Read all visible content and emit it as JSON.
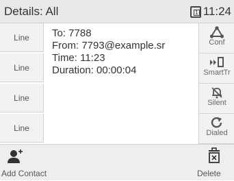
{
  "header": {
    "title": "Details: All",
    "line_badge": "1",
    "time": "11:24"
  },
  "line_keys": [
    "Line",
    "Line",
    "Line",
    "Line"
  ],
  "details": {
    "to": "To: 7788",
    "from": "From: 7793@example.sr",
    "time": "Time: 11:23",
    "duration": "Duration: 00:00:04"
  },
  "soft_keys": [
    {
      "label": "Conf",
      "icon": "conference-icon"
    },
    {
      "label": "SmartTr",
      "icon": "smart-transfer-icon"
    },
    {
      "label": "Silent",
      "icon": "silent-bell-icon"
    },
    {
      "label": "Dialed",
      "icon": "redial-icon"
    }
  ],
  "bottom": {
    "add_contact": "Add Contact",
    "delete": "Delete"
  }
}
